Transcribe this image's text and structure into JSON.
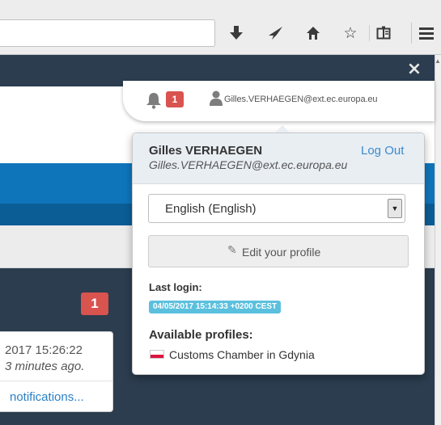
{
  "toolbar": {
    "icons": [
      "download-icon",
      "send-icon",
      "home-icon",
      "star-icon",
      "reading-list-icon",
      "menu-icon"
    ]
  },
  "page": {
    "close_symbol": "×",
    "notification_badge": "1",
    "notification_time": "2017 15:26:22",
    "notification_ago": "3 minutes ago.",
    "notifications_link": "notifications..."
  },
  "user_bar": {
    "bell_count": "1",
    "email": "Gilles.VERHAEGEN@ext.ec.europa.eu"
  },
  "popup": {
    "name": "Gilles VERHAEGEN",
    "email": "Gilles.VERHAEGEN@ext.ec.europa.eu",
    "logout_label": "Log Out",
    "language_value": "English (English)",
    "edit_profile_label": "Edit your profile",
    "last_login_label": "Last login:",
    "last_login_value": "04/05/2017 15:14:33 +0200 CEST",
    "profiles_label": "Available profiles:",
    "profiles": [
      "Customs Chamber in Gdynia"
    ]
  },
  "colors": {
    "dark_bg": "#2b3d4f",
    "brand_blue": "#0f75bb",
    "badge_red": "#d9534f",
    "info_blue": "#5bc0de",
    "link_blue": "#3a8bcd"
  }
}
